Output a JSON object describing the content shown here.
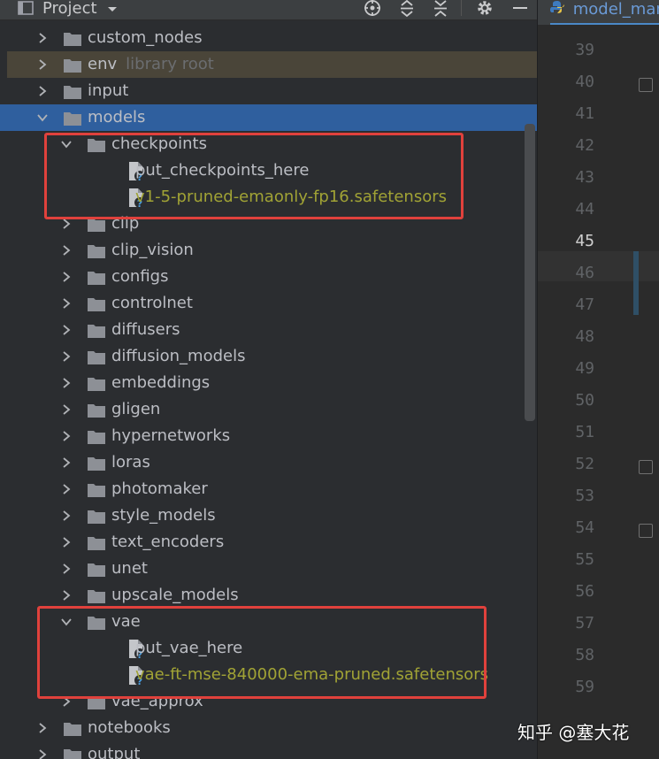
{
  "toolbar": {
    "title": "Project",
    "icons": [
      "project-view-icon",
      "dropdown-icon",
      "locate-icon",
      "expand-all-icon",
      "collapse-all-icon",
      "settings-gear-icon",
      "hide-icon"
    ]
  },
  "editor": {
    "tab_label": "model_man",
    "current_line": "45",
    "line_numbers": [
      "39",
      "40",
      "41",
      "42",
      "43",
      "44",
      "45",
      "46",
      "47",
      "48",
      "49",
      "50",
      "51",
      "52",
      "53",
      "54",
      "55",
      "56",
      "57",
      "58",
      "59"
    ]
  },
  "tree": [
    {
      "label": "custom_nodes",
      "expanded": false,
      "kind": "folder",
      "depth": 1
    },
    {
      "label": "env",
      "hint": "library root",
      "expanded": false,
      "kind": "folder",
      "depth": 1
    },
    {
      "label": "input",
      "expanded": false,
      "kind": "folder",
      "depth": 1
    },
    {
      "label": "models",
      "expanded": true,
      "kind": "folder",
      "depth": 1,
      "selected": true
    },
    {
      "label": "checkpoints",
      "expanded": true,
      "kind": "folder",
      "depth": 2
    },
    {
      "label": "put_checkpoints_here",
      "kind": "file",
      "depth": 3
    },
    {
      "label": "v1-5-pruned-emaonly-fp16.safetensors",
      "kind": "file",
      "depth": 3,
      "highlight": true
    },
    {
      "label": "clip",
      "expanded": false,
      "kind": "folder",
      "depth": 2
    },
    {
      "label": "clip_vision",
      "expanded": false,
      "kind": "folder",
      "depth": 2
    },
    {
      "label": "configs",
      "expanded": false,
      "kind": "folder",
      "depth": 2
    },
    {
      "label": "controlnet",
      "expanded": false,
      "kind": "folder",
      "depth": 2
    },
    {
      "label": "diffusers",
      "expanded": false,
      "kind": "folder",
      "depth": 2
    },
    {
      "label": "diffusion_models",
      "expanded": false,
      "kind": "folder",
      "depth": 2
    },
    {
      "label": "embeddings",
      "expanded": false,
      "kind": "folder",
      "depth": 2
    },
    {
      "label": "gligen",
      "expanded": false,
      "kind": "folder",
      "depth": 2
    },
    {
      "label": "hypernetworks",
      "expanded": false,
      "kind": "folder",
      "depth": 2
    },
    {
      "label": "loras",
      "expanded": false,
      "kind": "folder",
      "depth": 2
    },
    {
      "label": "photomaker",
      "expanded": false,
      "kind": "folder",
      "depth": 2
    },
    {
      "label": "style_models",
      "expanded": false,
      "kind": "folder",
      "depth": 2
    },
    {
      "label": "text_encoders",
      "expanded": false,
      "kind": "folder",
      "depth": 2
    },
    {
      "label": "unet",
      "expanded": false,
      "kind": "folder",
      "depth": 2
    },
    {
      "label": "upscale_models",
      "expanded": false,
      "kind": "folder",
      "depth": 2
    },
    {
      "label": "vae",
      "expanded": true,
      "kind": "folder",
      "depth": 2
    },
    {
      "label": "put_vae_here",
      "kind": "file",
      "depth": 3
    },
    {
      "label": "vae-ft-mse-840000-ema-pruned.safetensors",
      "kind": "file",
      "depth": 3,
      "highlight": true
    },
    {
      "label": "vae_approx",
      "expanded": false,
      "kind": "folder",
      "depth": 2
    },
    {
      "label": "notebooks",
      "expanded": false,
      "kind": "folder",
      "depth": 1
    },
    {
      "label": "output",
      "expanded": false,
      "kind": "folder",
      "depth": 1
    }
  ],
  "colors": {
    "selection": "#2f5f9e",
    "highlight_text": "#a1a335",
    "annotation_box": "#e0413c"
  },
  "watermark": "知乎 @塞大花"
}
